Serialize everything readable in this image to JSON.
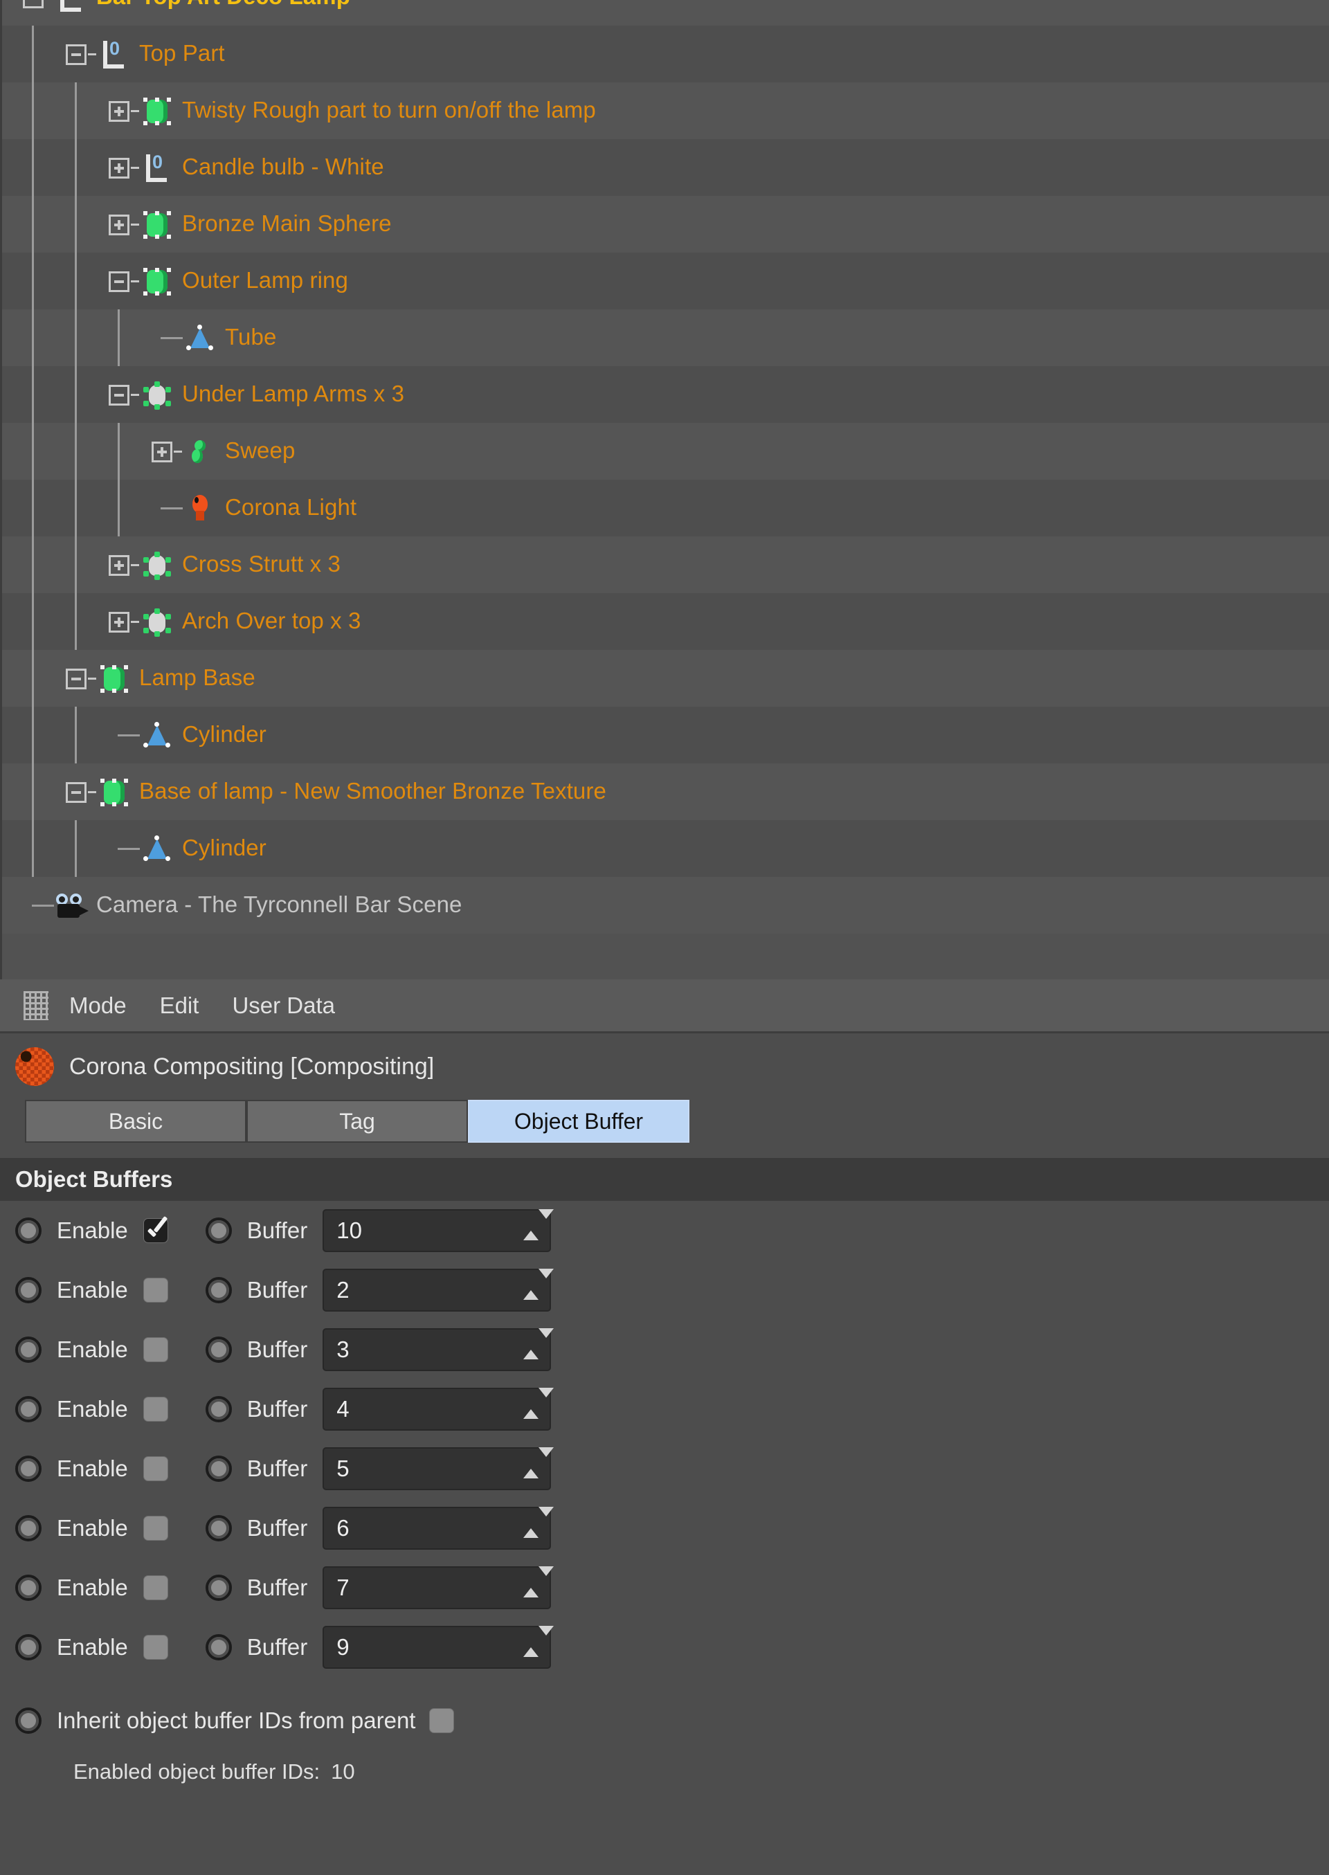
{
  "object_manager": {
    "tree": [
      {
        "name": "Bar Top Art Deco Lamp",
        "icon": "null-object-icon",
        "depth": 0,
        "expander": "minus",
        "highlight": "selected",
        "check": false,
        "tags": [
          "corona-compositing-tag"
        ]
      },
      {
        "name": "Top Part",
        "icon": "null-object-icon",
        "depth": 1,
        "expander": "minus",
        "highlight": "normal",
        "check": false,
        "tags": []
      },
      {
        "name": "Twisty Rough part to turn on/off the lamp",
        "icon": "polygon-object-icon",
        "depth": 2,
        "expander": "plus",
        "highlight": "normal",
        "check": true,
        "tags": []
      },
      {
        "name": "Candle bulb - White",
        "icon": "null-object-icon",
        "depth": 2,
        "expander": "plus",
        "highlight": "normal",
        "check": false,
        "tags": []
      },
      {
        "name": "Bronze Main Sphere",
        "icon": "polygon-object-icon",
        "depth": 2,
        "expander": "plus",
        "highlight": "normal",
        "check": true,
        "tags": [
          "material-bronze-tag"
        ]
      },
      {
        "name": "Outer Lamp ring",
        "icon": "polygon-object-icon",
        "depth": 2,
        "expander": "minus",
        "highlight": "normal",
        "check": true,
        "tags": []
      },
      {
        "name": "Tube",
        "icon": "primitive-object-icon",
        "depth": 3,
        "expander": "none",
        "highlight": "normal",
        "check": false,
        "tags": [
          "phong-tag",
          "uv-texture-tag",
          "material-bronze-tag",
          "selection-tag",
          "material-white-tag",
          "selection-tag"
        ]
      },
      {
        "name": "Under Lamp Arms x 3",
        "icon": "axis-object-icon",
        "depth": 2,
        "expander": "minus",
        "highlight": "normal",
        "check": true,
        "tags": []
      },
      {
        "name": "Sweep",
        "icon": "sweep-object-icon",
        "depth": 3,
        "expander": "plus",
        "highlight": "normal",
        "check": true,
        "tags": [
          "phong-tag",
          "material-bronze-bright-tag",
          "material-bronze-tag"
        ]
      },
      {
        "name": "Corona Light",
        "icon": "light-object-icon",
        "depth": 3,
        "expander": "none",
        "highlight": "normal",
        "check": true,
        "tags": []
      },
      {
        "name": "Cross Strutt x 3",
        "icon": "axis-object-icon",
        "depth": 2,
        "expander": "plus",
        "highlight": "normal",
        "check": true,
        "tags": [
          "material-bronze-bright-tag"
        ]
      },
      {
        "name": "Arch Over top x 3",
        "icon": "axis-object-icon",
        "depth": 2,
        "expander": "plus",
        "highlight": "normal",
        "check": true,
        "tags": [
          "material-bronze-tag"
        ]
      },
      {
        "name": "Lamp Base",
        "icon": "polygon-object-icon",
        "depth": 1,
        "expander": "minus",
        "highlight": "normal",
        "check": true,
        "tags": [
          "material-bronze-tag"
        ]
      },
      {
        "name": "Cylinder",
        "icon": "primitive-object-icon",
        "depth": 2,
        "expander": "none",
        "highlight": "normal",
        "check": false,
        "tags": [
          "phong-tag",
          "uv-texture-tag"
        ]
      },
      {
        "name": "Base of lamp - New Smoother Bronze Texture",
        "icon": "polygon-object-icon",
        "depth": 1,
        "expander": "minus",
        "highlight": "normal",
        "check": true,
        "tags": [
          "material-bronze-tag"
        ]
      },
      {
        "name": "Cylinder",
        "icon": "primitive-object-icon",
        "depth": 2,
        "expander": "none",
        "highlight": "normal",
        "check": false,
        "tags": [
          "phong-tag",
          "uv-texture-tag",
          "material-bronze-tag",
          "selection-tag",
          "material-bronze-tag",
          "selection-tag"
        ]
      },
      {
        "name": "Camera - The Tyrconnell Bar Scene",
        "icon": "camera-object-icon",
        "depth": 0,
        "expander": "none",
        "highlight": "dim",
        "check": false,
        "transform": true,
        "tags": [
          "camera-tag",
          "protection-tag"
        ]
      }
    ]
  },
  "attribute_manager": {
    "menubar": {
      "items": [
        "Mode",
        "Edit",
        "User Data"
      ]
    },
    "object": {
      "title": "Corona Compositing [Compositing]",
      "icon": "corona-compositing-icon"
    },
    "tabs": [
      {
        "label": "Basic",
        "active": false
      },
      {
        "label": "Tag",
        "active": false
      },
      {
        "label": "Object Buffer",
        "active": true
      }
    ],
    "section_title": "Object Buffers",
    "buffers": [
      {
        "enable_label": "Enable",
        "enabled": true,
        "buffer_label": "Buffer",
        "value": "10"
      },
      {
        "enable_label": "Enable",
        "enabled": false,
        "buffer_label": "Buffer",
        "value": "2"
      },
      {
        "enable_label": "Enable",
        "enabled": false,
        "buffer_label": "Buffer",
        "value": "3"
      },
      {
        "enable_label": "Enable",
        "enabled": false,
        "buffer_label": "Buffer",
        "value": "4"
      },
      {
        "enable_label": "Enable",
        "enabled": false,
        "buffer_label": "Buffer",
        "value": "5"
      },
      {
        "enable_label": "Enable",
        "enabled": false,
        "buffer_label": "Buffer",
        "value": "6"
      },
      {
        "enable_label": "Enable",
        "enabled": false,
        "buffer_label": "Buffer",
        "value": "7"
      },
      {
        "enable_label": "Enable",
        "enabled": false,
        "buffer_label": "Buffer",
        "value": "9"
      }
    ],
    "inherit": {
      "label": "Inherit object buffer IDs from parent",
      "checked": false
    },
    "enabled_ids": {
      "label": "Enabled object buffer IDs:",
      "value": "10"
    }
  },
  "colors": {
    "object_text": "#e08a0e",
    "selected_text": "#f5c012",
    "dim_text": "#c7c7c7",
    "accent_tab": "#bcd6f5",
    "check_green": "#2ee66e",
    "tag_orange": "#f2642f"
  }
}
